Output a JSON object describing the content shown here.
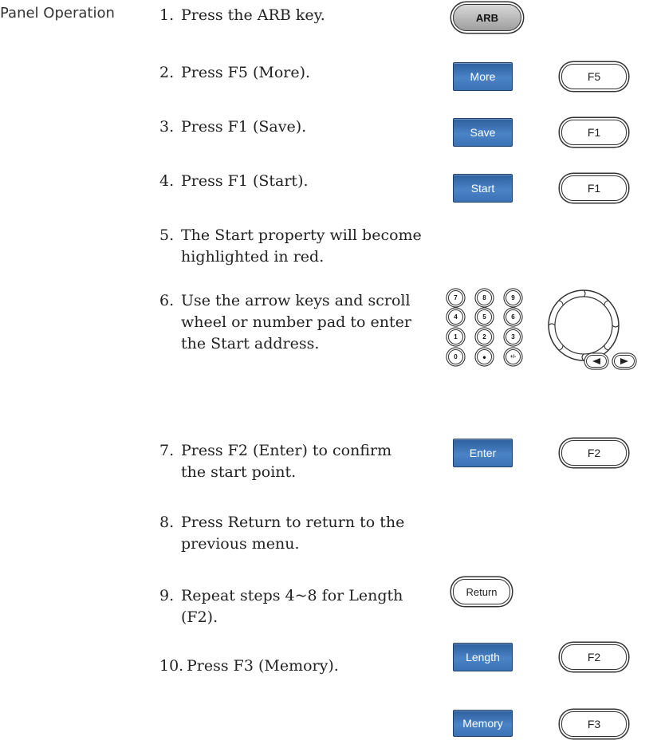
{
  "section_label": "Panel Operation",
  "steps": [
    {
      "num": "1.",
      "text": "Press the ARB key."
    },
    {
      "num": "2.",
      "text": "Press F5 (More)."
    },
    {
      "num": "3.",
      "text": "Press F1 (Save)."
    },
    {
      "num": "4.",
      "text": "Press F1 (Start)."
    },
    {
      "num": "5.",
      "text": "The Start property will become highlighted in red."
    },
    {
      "num": "6.",
      "text": "Use the arrow keys and scroll wheel or number pad to enter the Start address."
    },
    {
      "num": "7.",
      "text": "Press F2 (Enter) to confirm the start point."
    },
    {
      "num": "8.",
      "text": "Press Return to return to the previous menu."
    },
    {
      "num": "9.",
      "text": "Repeat steps 4~8 for Length (F2)."
    },
    {
      "num": "10.",
      "text": "Press F3 (Memory)."
    }
  ],
  "keys": {
    "arb": "ARB",
    "more": "More",
    "f5": "F5",
    "save": "Save",
    "f1_save": "F1",
    "start": "Start",
    "f1_start": "F1",
    "enter": "Enter",
    "f2_enter": "F2",
    "return": "Return",
    "length": "Length",
    "f2_length": "F2",
    "memory": "Memory",
    "f3": "F3"
  },
  "numpad": [
    "7",
    "8",
    "9",
    "4",
    "5",
    "6",
    "1",
    "2",
    "3",
    "0",
    "•",
    "+/-"
  ],
  "icons": {
    "scroll_wheel": "scroll-wheel-icon",
    "left_arrow": "left-arrow-key-icon",
    "right_arrow": "right-arrow-key-icon"
  },
  "colors": {
    "softkey_blue": "#3c72b5"
  }
}
